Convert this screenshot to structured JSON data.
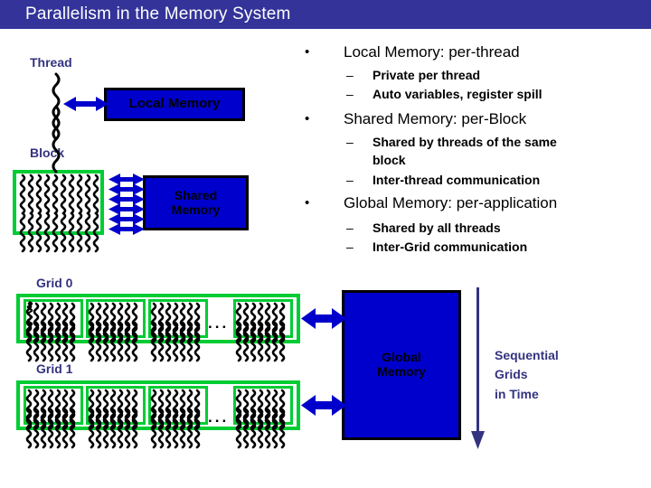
{
  "slide": {
    "title": "Parallelism in the Memory System",
    "title_bg": "#333399",
    "accent_green": "#00cc33",
    "accent_blue": "#0000cc",
    "label_navy": "#333380"
  },
  "diagram": {
    "thread_label": "Thread",
    "local_memory_box": "Local Memory",
    "block_label": "Block",
    "shared_memory_box_line1": "Shared",
    "shared_memory_box_line2": "Memory",
    "grid0_label": "Grid 0",
    "grid1_label": "Grid 1",
    "grid_ellipsis": "...",
    "global_memory_box_line1": "Global",
    "global_memory_box_line2": "Memory",
    "sequential_line1": "Sequential",
    "sequential_line2": "Grids",
    "sequential_line3": "in Time"
  },
  "bullets": [
    {
      "marker": "•",
      "text": "Local Memory:        per-thread",
      "subs": [
        {
          "marker": "–",
          "text": "Private per thread"
        },
        {
          "marker": "–",
          "text": "Auto variables, register spill"
        }
      ]
    },
    {
      "marker": "•",
      "text": "Shared Memory:     per-Block",
      "subs": [
        {
          "marker": "–",
          "text": "Shared by threads of the same"
        },
        {
          "marker": "",
          "text": "block"
        },
        {
          "marker": "–",
          "text": "Inter-thread communication"
        }
      ]
    },
    {
      "marker": "•",
      "text": "Global Memory:   per-application",
      "subs": [
        {
          "marker": "–",
          "text": "Shared by all threads"
        },
        {
          "marker": "–",
          "text": "Inter-Grid communication"
        }
      ]
    }
  ]
}
